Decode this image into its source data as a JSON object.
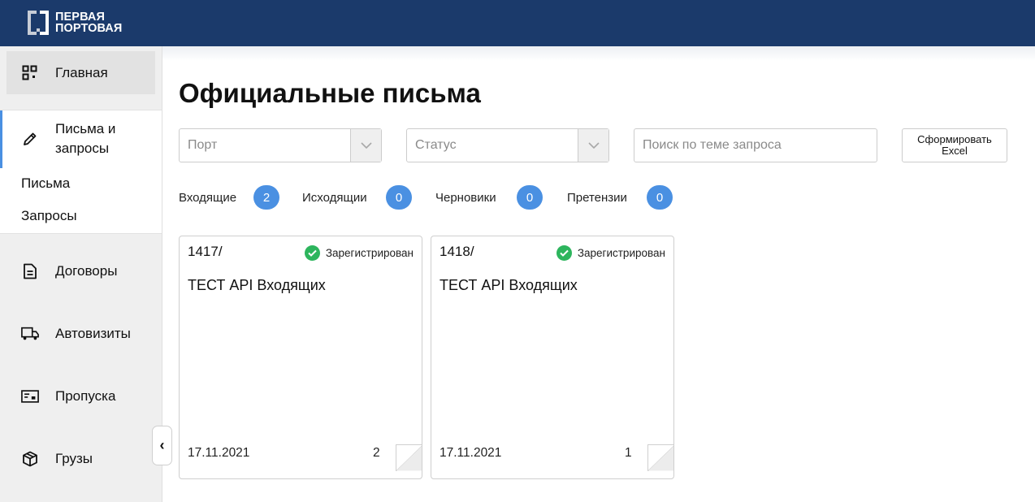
{
  "logo": {
    "line1": "ПЕРВАЯ",
    "line2": "ПОРТОВАЯ"
  },
  "sidebar": {
    "home": {
      "label": "Главная",
      "icon": "grid-icon"
    },
    "letters": {
      "label": "Письма и запросы",
      "icon": "pencil-icon",
      "sub_items": [
        "Письма",
        "Запросы"
      ]
    },
    "items": [
      {
        "label": "Договоры",
        "icon": "document-icon"
      },
      {
        "label": "Автовизиты",
        "icon": "truck-icon"
      },
      {
        "label": "Пропуска",
        "icon": "pass-card-icon"
      },
      {
        "label": "Грузы",
        "icon": "box-icon"
      }
    ],
    "collapse_glyph": "‹"
  },
  "page": {
    "title": "Официальные письма"
  },
  "filters": {
    "port_placeholder": "Порт",
    "status_placeholder": "Статус",
    "search_placeholder": "Поиск по теме запроса",
    "excel_button": "Сформировать Excel"
  },
  "tabs": [
    {
      "label": "Входящие",
      "count": "2"
    },
    {
      "label": "Исходящии",
      "count": "0"
    },
    {
      "label": "Черновики",
      "count": "0"
    },
    {
      "label": "Претензии",
      "count": "0"
    }
  ],
  "cards": [
    {
      "number": "1417/",
      "status": "Зарегистрирован",
      "subject": "ТЕСТ API Входящих",
      "date": "17.11.2021",
      "count": "2"
    },
    {
      "number": "1418/",
      "status": "Зарегистрирован",
      "subject": "ТЕСТ API Входящих",
      "date": "17.11.2021",
      "count": "1"
    }
  ],
  "colors": {
    "header": "#1b3a6b",
    "accent": "#4a90e2",
    "status_ok": "#2db55d"
  }
}
